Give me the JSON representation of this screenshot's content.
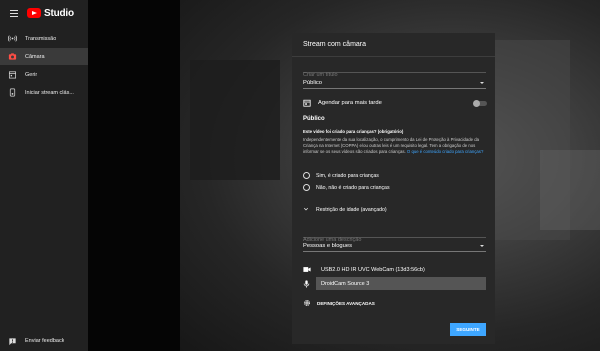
{
  "app": {
    "logo_text": "Studio"
  },
  "sidebar": {
    "items": [
      {
        "label": "Transmissão",
        "icon": "broadcast-icon",
        "active": false
      },
      {
        "label": "Câmara",
        "icon": "camera-icon",
        "active": true
      },
      {
        "label": "Gerir",
        "icon": "calendar-icon",
        "active": false
      },
      {
        "label": "Iniciar stream clás...",
        "icon": "encoder-icon",
        "active": false
      }
    ],
    "feedback": {
      "label": "Enviar feedback",
      "icon": "feedback-icon"
    }
  },
  "dialog": {
    "title": "Stream com câmara",
    "title_placeholder": "Criar um título",
    "visibility_value": "Público",
    "schedule_label": "Agendar para mais tarde",
    "schedule_on": false,
    "audience": {
      "heading": "Público",
      "question": "Este vídeo foi criado para crianças? (obrigatório)",
      "description": "Independentemente da sua localização, o cumprimento da Lei de Proteção à Privacidade da Criança na Internet (COPPA) e/ou outras leis é um requisito legal. Tem a obrigação de nos informar se os seus vídeos são criados para crianças.",
      "link_text": "O que é conteúdo criado para crianças?",
      "option_yes": "Sim, é criado para crianças",
      "option_no": "Não, não é criado para crianças",
      "age_restriction": "Restrição de idade (avançado)"
    },
    "description_placeholder": "Adicione uma descrição",
    "category_value": "Pessoas e blogues",
    "camera_device": "USB2.0 HD IR UVC WebCam (13d3:56cb)",
    "mic_device": "DroidCam Source 3",
    "advanced_label": "DEFINIÇÕES AVANÇADAS",
    "next_button": "SEGUINTE"
  },
  "colors": {
    "accent": "#3ea6ff",
    "brand": "#ff0000"
  }
}
